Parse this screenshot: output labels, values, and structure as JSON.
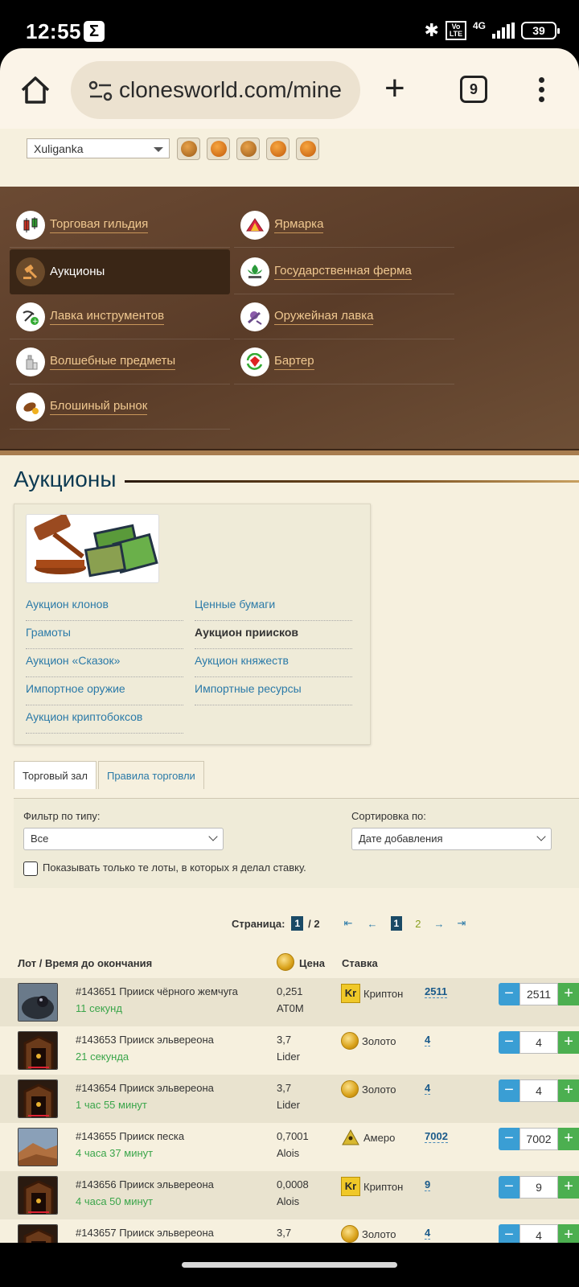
{
  "status_bar": {
    "time": "12:55",
    "notification_icon": "Σ",
    "volte": "Vo LTE",
    "network": "4G",
    "battery": "39"
  },
  "browser": {
    "url": "clonesworld.com/mine",
    "tabs_count": "9",
    "icons": [
      "home-icon",
      "site-settings-icon",
      "plus-icon",
      "tabs-icon",
      "menu-icon"
    ]
  },
  "user": {
    "selected": "Xuliganka"
  },
  "menu": [
    {
      "label": "Торговая гильдия",
      "icon": "candlestick-icon",
      "active": false
    },
    {
      "label": "Ярмарка",
      "icon": "tent-icon",
      "active": false
    },
    {
      "label": "Аукционы",
      "icon": "gavel-icon",
      "active": true
    },
    {
      "label": "Государственная ферма",
      "icon": "farm-icon",
      "active": false
    },
    {
      "label": "Лавка инструментов",
      "icon": "tools-icon",
      "active": false
    },
    {
      "label": "Оружейная лавка",
      "icon": "weapon-icon",
      "active": false
    },
    {
      "label": "Волшебные предметы",
      "icon": "magic-icon",
      "active": false
    },
    {
      "label": "Бартер",
      "icon": "barter-icon",
      "active": false
    },
    {
      "label": "Блошиный рынок",
      "icon": "flea-icon",
      "active": false
    }
  ],
  "page_title": "Аукционы",
  "auction_links": [
    {
      "label": "Аукцион клонов",
      "current": false
    },
    {
      "label": "Ценные бумаги",
      "current": false
    },
    {
      "label": "Грамоты",
      "current": false
    },
    {
      "label": "Аукцион приисков",
      "current": true
    },
    {
      "label": "Аукцион «Сказок»",
      "current": false
    },
    {
      "label": "Аукцион княжеств",
      "current": false
    },
    {
      "label": "Импортное оружие",
      "current": false
    },
    {
      "label": "Импортные ресурсы",
      "current": false
    },
    {
      "label": "Аукцион криптобоксов",
      "current": false
    }
  ],
  "tabs": {
    "hall": "Торговый зал",
    "rules": "Правила торговли"
  },
  "filter": {
    "type_label": "Фильтр по типу:",
    "type_value": "Все",
    "sort_label": "Сортировка по:",
    "sort_value": "Дате добавления",
    "checkbox_label": "Показывать только те лоты, в которых я делал ставку."
  },
  "pager": {
    "label": "Страница:",
    "current": "1",
    "total": "/ 2",
    "page1": "1",
    "page2": "2",
    "first": "⇤",
    "prev": "←",
    "next": "→",
    "last": "⇥"
  },
  "table_head": {
    "lot": "Лот / Время до окончания",
    "price": "Цена",
    "bid": "Ставка"
  },
  "rows": [
    {
      "title": "#143651 Прииск чёрного жемчуга",
      "time": "11 секунд",
      "price": "0,251",
      "seller": "AT0M",
      "currency": "Криптон",
      "cur_type": "kr",
      "bid": "2511",
      "amount": "2511",
      "thumb": "pearl"
    },
    {
      "title": "#143653 Прииск эльвереона",
      "time": "21 секунда",
      "price": "3,7",
      "seller": "Lider",
      "currency": "Золото",
      "cur_type": "gold",
      "bid": "4",
      "amount": "4",
      "thumb": "mine"
    },
    {
      "title": "#143654 Прииск эльвереона",
      "time": "1 час 55 минут",
      "price": "3,7",
      "seller": "Lider",
      "currency": "Золото",
      "cur_type": "gold",
      "bid": "4",
      "amount": "4",
      "thumb": "mine"
    },
    {
      "title": "#143655 Прииск песка",
      "time": "4 часа 37 минут",
      "price": "0,7001",
      "seller": "Alois",
      "currency": "Амеро",
      "cur_type": "amero",
      "bid": "7002",
      "amount": "7002",
      "thumb": "sand"
    },
    {
      "title": "#143656 Прииск эльвереона",
      "time": "4 часа 50 минут",
      "price": "0,0008",
      "seller": "Alois",
      "currency": "Криптон",
      "cur_type": "kr",
      "bid": "9",
      "amount": "9",
      "thumb": "mine"
    },
    {
      "title": "#143657 Прииск эльвереона",
      "time": "",
      "price": "3,7",
      "seller": "",
      "currency": "Золото",
      "cur_type": "gold",
      "bid": "4",
      "amount": "4",
      "thumb": "mine"
    }
  ],
  "colors": {
    "leather": "#5a3c28",
    "link": "#2b7aa8",
    "timer": "#3aa54a",
    "minus": "#3a9ed4",
    "plus": "#4caf50"
  }
}
